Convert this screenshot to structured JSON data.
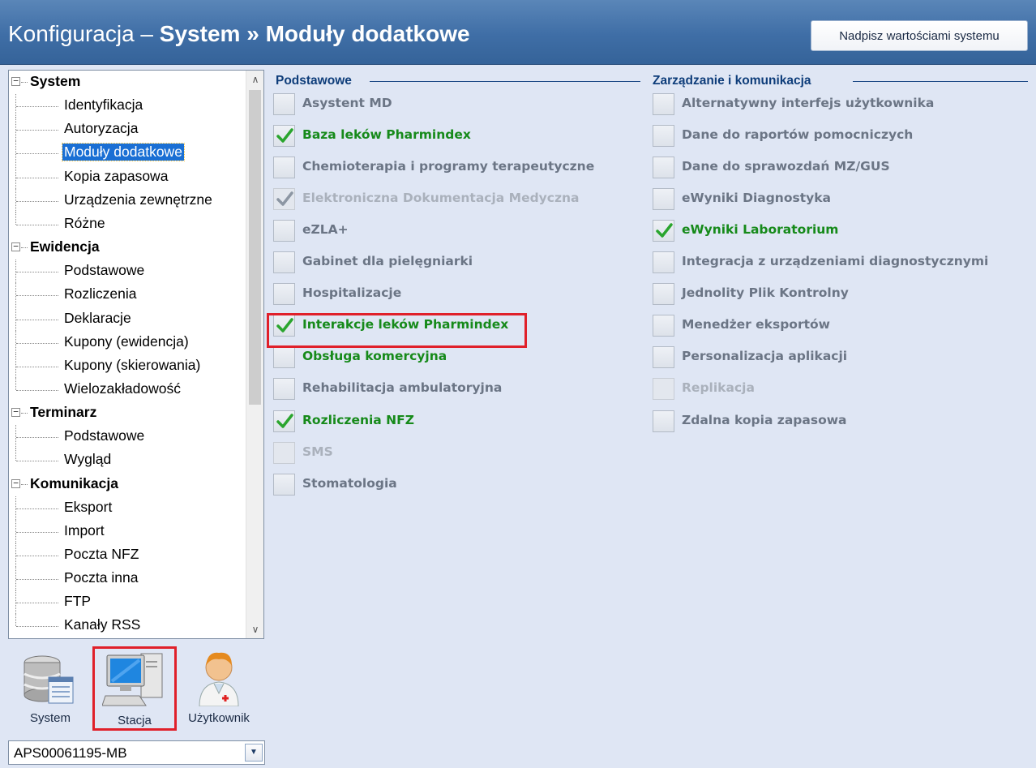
{
  "header": {
    "title_prefix": "Konfiguracja – ",
    "title_section": "System",
    "title_sep": " » ",
    "title_page": "Moduły dodatkowe",
    "override_button": "Nadpisz wartościami systemu"
  },
  "tree": {
    "categories": [
      {
        "label": "System",
        "expander": "−",
        "items": [
          "Identyfikacja",
          "Autoryzacja",
          "Moduły dodatkowe",
          "Kopia zapasowa",
          "Urządzenia zewnętrzne",
          "Różne"
        ]
      },
      {
        "label": "Ewidencja",
        "expander": "−",
        "items": [
          "Podstawowe",
          "Rozliczenia",
          "Deklaracje",
          "Kupony (ewidencja)",
          "Kupony (skierowania)",
          "Wielozakładowość"
        ]
      },
      {
        "label": "Terminarz",
        "expander": "−",
        "items": [
          "Podstawowe",
          "Wygląd"
        ]
      },
      {
        "label": "Komunikacja",
        "expander": "−",
        "items": [
          "Eksport",
          "Import",
          "Poczta NFZ",
          "Poczta inna",
          "FTP",
          "Kanały RSS"
        ]
      }
    ],
    "selected": "Moduły dodatkowe",
    "scroll_up": "∧",
    "scroll_down": "∨"
  },
  "tiles": [
    {
      "label": "System",
      "icon": "database-icon"
    },
    {
      "label": "Stacja",
      "icon": "workstation-icon"
    },
    {
      "label": "Użytkownik",
      "icon": "user-doctor-icon"
    }
  ],
  "station_select": {
    "value": "APS00061195-MB",
    "arrow": "▼"
  },
  "groups": {
    "basic": {
      "title": "Podstawowe",
      "modules": [
        {
          "label": "Asystent MD",
          "state": "off"
        },
        {
          "label": "Baza leków Pharmindex",
          "state": "on"
        },
        {
          "label": "Chemioterapia i programy terapeutyczne",
          "state": "off"
        },
        {
          "label": "Elektroniczna Dokumentacja Medyczna",
          "state": "disabled-checked"
        },
        {
          "label": "eZLA+",
          "state": "off"
        },
        {
          "label": "Gabinet dla pielęgniarki",
          "state": "off"
        },
        {
          "label": "Hospitalizacje",
          "state": "off"
        },
        {
          "label": "Interakcje leków Pharmindex",
          "state": "on"
        },
        {
          "label": "Obsługa komercyjna",
          "state": "on-unchecked"
        },
        {
          "label": "Rehabilitacja ambulatoryjna",
          "state": "off"
        },
        {
          "label": "Rozliczenia NFZ",
          "state": "on"
        },
        {
          "label": "SMS",
          "state": "disabled"
        },
        {
          "label": "Stomatologia",
          "state": "off"
        }
      ]
    },
    "management": {
      "title": "Zarządzanie i komunikacja",
      "modules": [
        {
          "label": "Alternatywny interfejs użytkownika",
          "state": "off"
        },
        {
          "label": "Dane do raportów pomocniczych",
          "state": "off"
        },
        {
          "label": "Dane do sprawozdań MZ/GUS",
          "state": "off"
        },
        {
          "label": "eWyniki Diagnostyka",
          "state": "off"
        },
        {
          "label": "eWyniki Laboratorium",
          "state": "on"
        },
        {
          "label": "Integracja z urządzeniami diagnostycznymi",
          "state": "off"
        },
        {
          "label": "Jednolity Plik Kontrolny",
          "state": "off"
        },
        {
          "label": "Menedżer eksportów",
          "state": "off"
        },
        {
          "label": "Personalizacja aplikacji",
          "state": "off"
        },
        {
          "label": "Replikacja",
          "state": "disabled"
        },
        {
          "label": "Zdalna kopia zapasowa",
          "state": "off"
        }
      ]
    }
  },
  "colors": {
    "header": "#3f6ea6",
    "accent_checked": "#168a1a",
    "highlight": "#e0202a",
    "selection": "#1a6fd4"
  }
}
